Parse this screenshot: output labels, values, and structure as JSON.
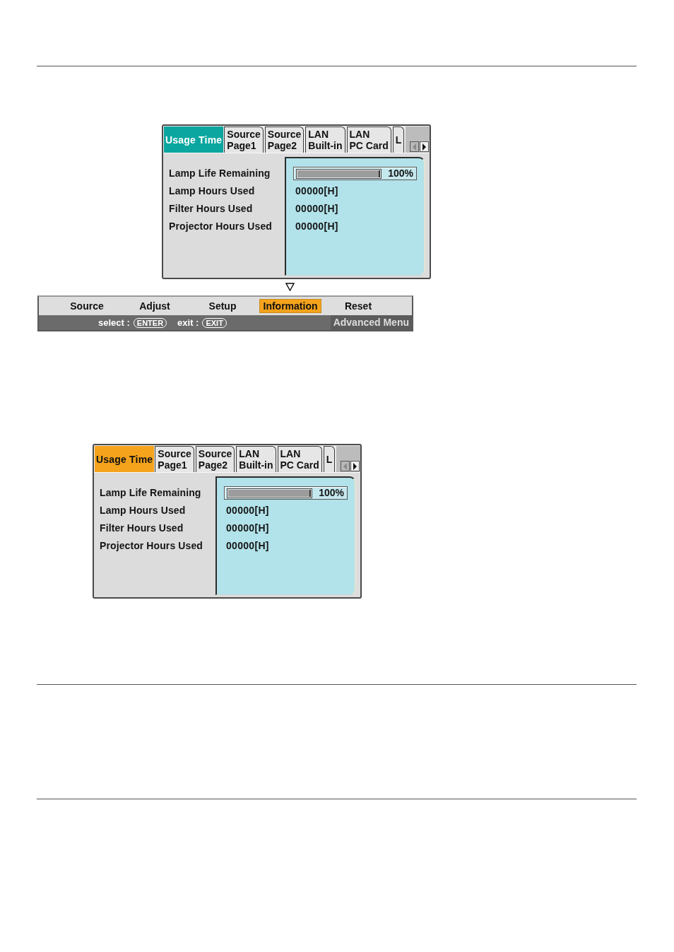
{
  "upper_osd": {
    "color": "#0ba69f",
    "tabs": [
      {
        "label": "Usage Time",
        "selected": true
      },
      {
        "label": "Source\nPage1",
        "selected": false
      },
      {
        "label": "Source\nPage2",
        "selected": false
      },
      {
        "label": "LAN\nBuilt-in",
        "selected": false
      },
      {
        "label": "LAN\nPC Card",
        "selected": false
      },
      {
        "label": "L",
        "selected": false
      }
    ],
    "scroll_buttons": [
      {
        "kind": "left",
        "disabled": true
      },
      {
        "kind": "right",
        "disabled": false
      }
    ],
    "rows": [
      {
        "kind": "bar",
        "label": "Lamp Life Remaining",
        "level": 1,
        "reading": "100%"
      },
      {
        "kind": "text",
        "label": "Lamp Hours Used",
        "value": "00000[H]"
      },
      {
        "kind": "text",
        "label": "Filter Hours Used",
        "value": "00000[H]"
      },
      {
        "kind": "text",
        "label": "Projector Hours Used",
        "value": "00000[H]"
      }
    ]
  },
  "menu_bar": {
    "items": [
      {
        "label": "Source",
        "selected": false
      },
      {
        "label": "Adjust",
        "selected": false
      },
      {
        "label": "Setup",
        "selected": false
      },
      {
        "label": "Information",
        "selected": true
      },
      {
        "label": "Reset",
        "selected": false
      }
    ],
    "hints": [
      {
        "kind": "text",
        "text": "select :"
      },
      {
        "kind": "key",
        "text": "ENTER"
      },
      {
        "kind": "text",
        "text": "exit :"
      },
      {
        "kind": "key",
        "text": "EXIT"
      }
    ],
    "mode": "Advanced Menu"
  },
  "lower_osd": {
    "color": "#f5a31c",
    "tabs": [
      {
        "label": "Usage Time",
        "selected": true
      },
      {
        "label": "Source\nPage1",
        "selected": false
      },
      {
        "label": "Source\nPage2",
        "selected": false
      },
      {
        "label": "LAN\nBuilt-in",
        "selected": false
      },
      {
        "label": "LAN\nPC Card",
        "selected": false
      },
      {
        "label": "L",
        "selected": false
      }
    ],
    "scroll_buttons": [
      {
        "kind": "left",
        "disabled": true
      },
      {
        "kind": "right",
        "disabled": false
      }
    ],
    "rows": [
      {
        "kind": "bar",
        "label": "Lamp Life Remaining",
        "level": 1,
        "reading": "100%"
      },
      {
        "kind": "text",
        "label": "Lamp Hours Used",
        "value": "00000[H]"
      },
      {
        "kind": "text",
        "label": "Filter Hours Used",
        "value": "00000[H]"
      },
      {
        "kind": "text",
        "label": "Projector Hours Used",
        "value": "00000[H]"
      }
    ]
  }
}
